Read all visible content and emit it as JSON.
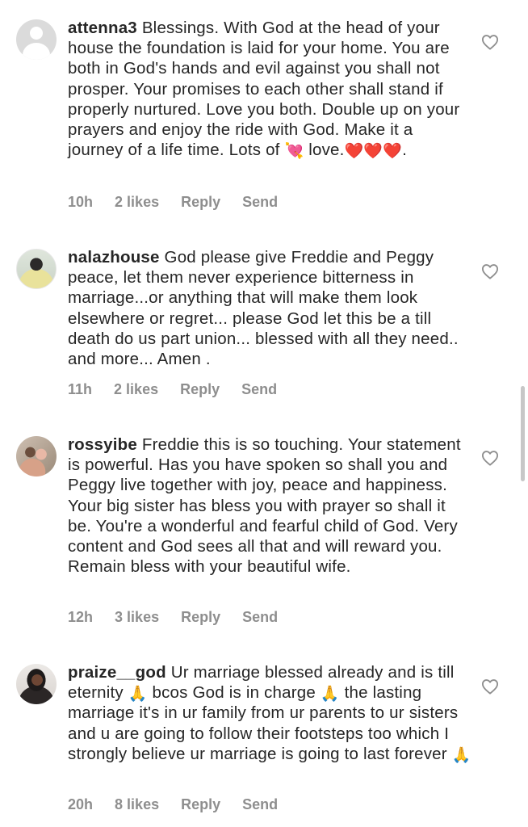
{
  "comments": [
    {
      "username": "attenna3",
      "avatar": "default-avatar",
      "segments": [
        "Blessings. With God at the head of your house the foundation is laid for your home. You are both in God's hands and evil against you shall not prosper. Your promises to each other shall stand if properly nurtured. Love you both. Double up on your prayers and enjoy the ride with God. Make it a journey of a life time. Lots of ",
        "💘",
        " love.",
        "❤️❤️❤️",
        "."
      ],
      "time": "10h",
      "likes": "2 likes",
      "reply": "Reply",
      "send": "Send"
    },
    {
      "username": "nalazhouse",
      "avatar": "profile-photo",
      "segments": [
        "God please give Freddie and Peggy peace, let them never experience bitterness in marriage...or anything that will make them look elsewhere or regret... please God let this be a till death do us part union... blessed with all they need.. and more... Amen ."
      ],
      "time": "11h",
      "likes": "2 likes",
      "reply": "Reply",
      "send": "Send"
    },
    {
      "username": "rossyibe",
      "avatar": "profile-photo",
      "segments": [
        "Freddie this is so touching. Your statement is powerful. Has you have spoken so shall you and Peggy live together with joy, peace and happiness. Your big sister has bless you with prayer so shall it be. You're a wonderful and fearful child of God. Very content and God sees all that and will reward you. Remain bless with your beautiful wife."
      ],
      "time": "12h",
      "likes": "3 likes",
      "reply": "Reply",
      "send": "Send"
    },
    {
      "username": "praize__god",
      "avatar": "profile-photo",
      "segments": [
        "Ur marriage blessed already and is till eternity ",
        "🙏",
        " bcos God is in charge ",
        "🙏",
        " the lasting marriage it's in ur family from ur parents to ur sisters and u are going to follow their footsteps too which I strongly believe ur marriage is going to last forever ",
        "🙏"
      ],
      "time": "20h",
      "likes": "8 likes",
      "reply": "Reply",
      "send": "Send"
    }
  ],
  "icons": {
    "like": "heart-outline-icon"
  },
  "colors": {
    "text": "#262626",
    "meta": "#8e8e8e",
    "icon": "#8e8e8e",
    "red_heart": "#e0142b",
    "scrollbar": "#c7c7c7"
  }
}
